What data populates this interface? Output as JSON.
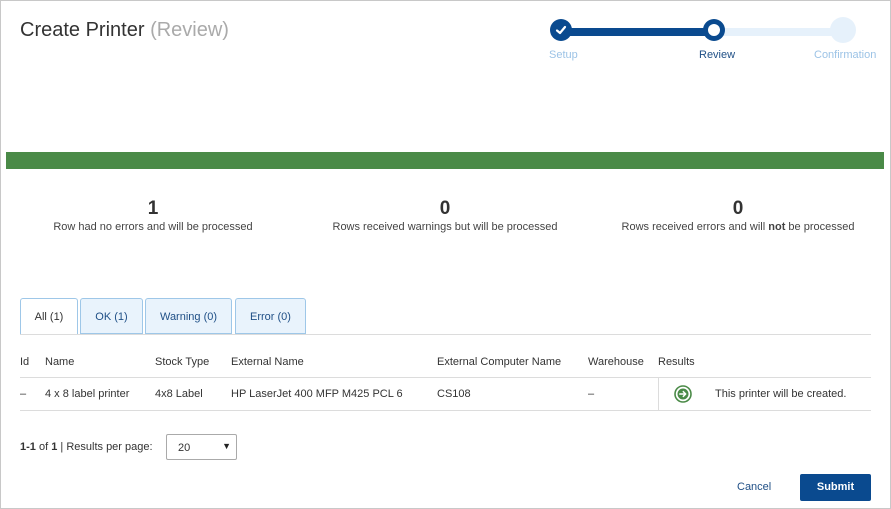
{
  "header": {
    "title": "Create Printer",
    "title_suffix": "(Review)"
  },
  "stepper": {
    "steps": [
      {
        "label": "Setup",
        "state": "complete"
      },
      {
        "label": "Review",
        "state": "current"
      },
      {
        "label": "Confirmation",
        "state": "upcoming"
      }
    ]
  },
  "status_bar_color": "#4a8a47",
  "summary": [
    {
      "count": "1",
      "text": "Row had no errors and will be processed"
    },
    {
      "count": "0",
      "text": "Rows received warnings but will be processed"
    },
    {
      "count": "0",
      "text_before": "Rows received errors and will ",
      "text_bold": "not",
      "text_after": " be processed"
    }
  ],
  "tabs": [
    {
      "label": "All (1)",
      "active": true
    },
    {
      "label": "OK (1)",
      "active": false
    },
    {
      "label": "Warning (0)",
      "active": false
    },
    {
      "label": "Error (0)",
      "active": false
    }
  ],
  "table": {
    "columns": [
      "Id",
      "Name",
      "Stock Type",
      "External Name",
      "External Computer Name",
      "Warehouse",
      "Results"
    ],
    "rows": [
      {
        "id": "–",
        "name": "4 x 8 label printer",
        "stock_type": "4x8 Label",
        "external_name": "HP LaserJet 400 MFP M425 PCL 6",
        "external_computer_name": "CS108",
        "warehouse": "–",
        "result_icon": "arrow-right-circle-icon",
        "result_text": "This printer will be created."
      }
    ]
  },
  "pagination": {
    "range": "1-1",
    "of_label": "of",
    "total": "1",
    "per_page_label": "Results per page:",
    "per_page_value": "20"
  },
  "actions": {
    "cancel_label": "Cancel",
    "submit_label": "Submit"
  },
  "colors": {
    "primary": "#0a4a8f",
    "success": "#4a8a47",
    "link": "#1f4f86"
  }
}
